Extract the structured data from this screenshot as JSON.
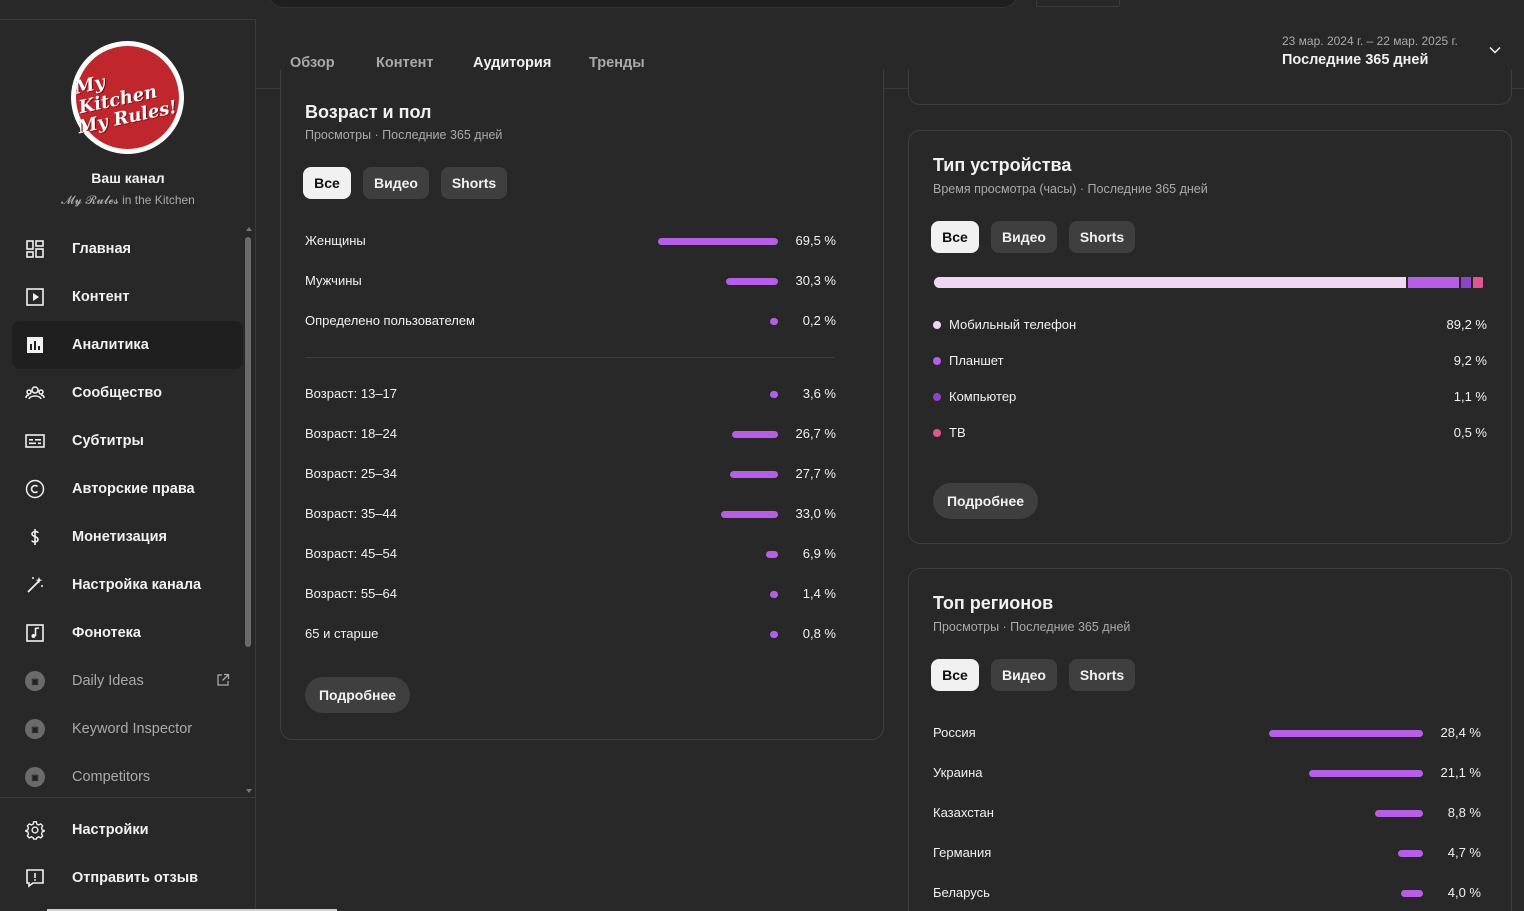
{
  "channel": {
    "title": "Ваш канал",
    "subtitle": "𝓜𝔂 𝓡𝓾𝓵𝓮𝓼 in the Kitchen",
    "logo_line1": "My Kitchen",
    "logo_line2": "My Rules!"
  },
  "nav": [
    {
      "label": "Главная",
      "icon": "dashboard-icon"
    },
    {
      "label": "Контент",
      "icon": "content-icon"
    },
    {
      "label": "Аналитика",
      "icon": "analytics-icon",
      "active": true
    },
    {
      "label": "Сообщество",
      "icon": "community-icon"
    },
    {
      "label": "Субтитры",
      "icon": "subtitles-icon"
    },
    {
      "label": "Авторские права",
      "icon": "copyright-icon"
    },
    {
      "label": "Монетизация",
      "icon": "monetization-icon"
    },
    {
      "label": "Настройка канала",
      "icon": "customization-icon"
    },
    {
      "label": "Фонотека",
      "icon": "audio-library-icon"
    },
    {
      "label": "Daily Ideas",
      "icon": "extension-icon",
      "external": true
    },
    {
      "label": "Keyword Inspector",
      "icon": "extension-icon"
    },
    {
      "label": "Competitors",
      "icon": "extension-icon"
    }
  ],
  "bottom_nav": [
    {
      "label": "Настройки",
      "icon": "settings-icon"
    },
    {
      "label": "Отправить отзыв",
      "icon": "feedback-icon"
    }
  ],
  "tabs": [
    {
      "label": "Обзор"
    },
    {
      "label": "Контент"
    },
    {
      "label": "Аудитория",
      "active": true
    },
    {
      "label": "Тренды"
    }
  ],
  "date": {
    "range": "23 мар. 2024 г. – 22 мар. 2025 г.",
    "period": "Последние 365 дней"
  },
  "chips": {
    "all": "Все",
    "video": "Видео",
    "shorts": "Shorts"
  },
  "more_label": "Подробнее",
  "age_gender": {
    "title": "Возраст и пол",
    "subtitle": "Просмотры · Последние 365 дней",
    "gender": [
      {
        "label": "Женщины",
        "value": "69,5 %",
        "pct": 69.5
      },
      {
        "label": "Мужчины",
        "value": "30,3 %",
        "pct": 30.3
      },
      {
        "label": "Определено пользователем",
        "value": "0,2 %",
        "pct": 0.2
      }
    ],
    "ages": [
      {
        "label": "Возраст: 13–17",
        "value": "3,6 %",
        "pct": 3.6
      },
      {
        "label": "Возраст: 18–24",
        "value": "26,7 %",
        "pct": 26.7
      },
      {
        "label": "Возраст: 25–34",
        "value": "27,7 %",
        "pct": 27.7
      },
      {
        "label": "Возраст: 35–44",
        "value": "33,0 %",
        "pct": 33.0
      },
      {
        "label": "Возраст: 45–54",
        "value": "6,9 %",
        "pct": 6.9
      },
      {
        "label": "Возраст: 55–64",
        "value": "1,4 %",
        "pct": 1.4
      },
      {
        "label": "65 и старше",
        "value": "0,8 %",
        "pct": 0.8
      }
    ]
  },
  "device": {
    "title": "Тип устройства",
    "subtitle": "Время просмотра (часы) · Последние 365 дней",
    "items": [
      {
        "label": "Мобильный телефон",
        "value": "89,2 %",
        "pct": 89.2,
        "color": "#f0d8f5"
      },
      {
        "label": "Планшет",
        "value": "9,2 %",
        "pct": 9.2,
        "color": "#b65ee5"
      },
      {
        "label": "Компьютер",
        "value": "1,1 %",
        "pct": 1.1,
        "color": "#8e44c9"
      },
      {
        "label": "ТВ",
        "value": "0,5 %",
        "pct": 0.5,
        "color": "#e0568f"
      }
    ]
  },
  "regions": {
    "title": "Топ регионов",
    "subtitle": "Просмотры · Последние 365 дней",
    "items": [
      {
        "label": "Россия",
        "value": "28,4 %",
        "pct": 28.4
      },
      {
        "label": "Украина",
        "value": "21,1 %",
        "pct": 21.1
      },
      {
        "label": "Казахстан",
        "value": "8,8 %",
        "pct": 8.8
      },
      {
        "label": "Германия",
        "value": "4,7 %",
        "pct": 4.7
      },
      {
        "label": "Беларусь",
        "value": "4,0 %",
        "pct": 4.0
      }
    ]
  }
}
